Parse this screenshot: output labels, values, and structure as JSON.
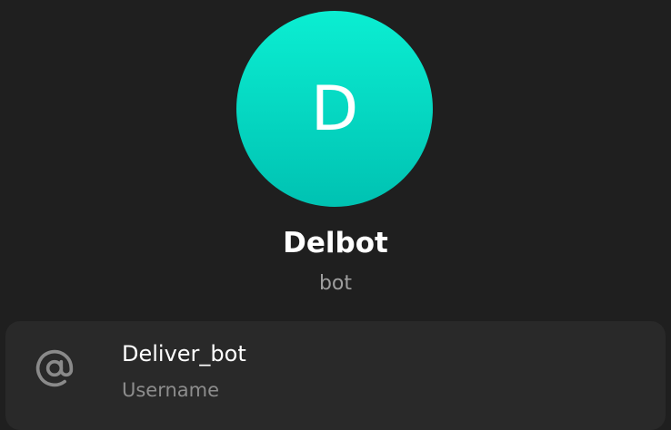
{
  "profile": {
    "avatar_letter": "D",
    "name": "Delbot",
    "subtitle": "bot"
  },
  "info": {
    "username_value": "Deliver_bot",
    "username_label": "Username",
    "username_icon": "at-icon"
  },
  "colors": {
    "background": "#1f1f1f",
    "card": "#292929",
    "avatar_top": "#0beed2",
    "avatar_bottom": "#00c2b2"
  }
}
